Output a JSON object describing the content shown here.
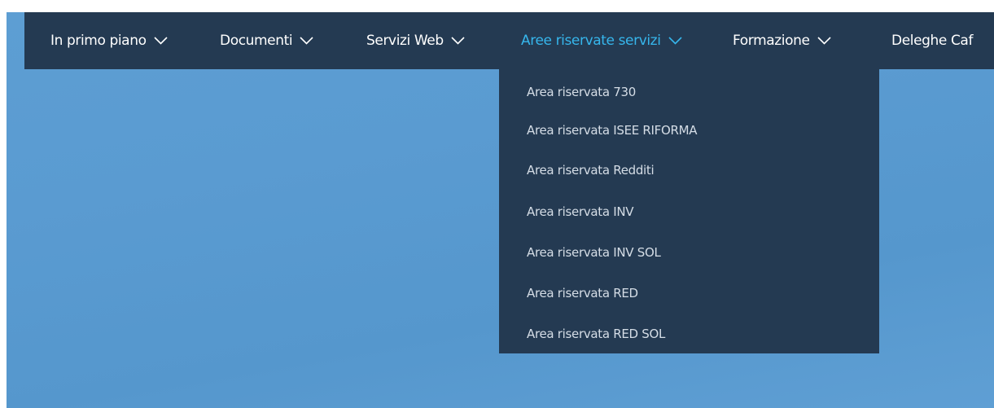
{
  "nav": {
    "items": [
      {
        "label": "In primo piano",
        "has_chevron": true
      },
      {
        "label": "Documenti",
        "has_chevron": true
      },
      {
        "label": "Servizi Web",
        "has_chevron": true
      },
      {
        "label": "Aree riservate servizi",
        "has_chevron": true,
        "active": true
      },
      {
        "label": "Formazione",
        "has_chevron": true
      },
      {
        "label": "Deleghe Caf",
        "has_chevron": false
      }
    ]
  },
  "dropdown": {
    "items": [
      {
        "label": "Area riservata 730"
      },
      {
        "label": "Area riservata ISEE RIFORMA"
      },
      {
        "label": "Area riservata Redditi"
      },
      {
        "label": "Area riservata INV"
      },
      {
        "label": "Area riservata INV SOL"
      },
      {
        "label": "Area riservata RED"
      },
      {
        "label": "Area riservata RED SOL"
      }
    ]
  },
  "colors": {
    "nav_bg": "#243a52",
    "active_text": "#36b6ec",
    "page_bg": "#5a9bd1"
  },
  "icons": {
    "chevron": "chevron-down-icon"
  }
}
